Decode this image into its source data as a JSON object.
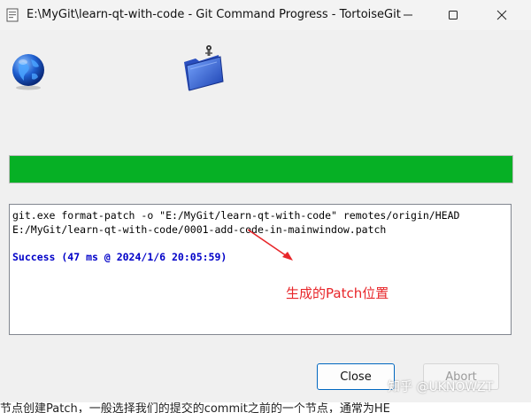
{
  "window": {
    "title": "E:\\MyGit\\learn-qt-with-code - Git Command Progress - TortoiseGit"
  },
  "icons": {
    "app": "tortoisegit-app-icon",
    "globe": "globe-icon",
    "folder": "folder-icon",
    "minimize": "minimize-icon",
    "maximize": "maximize-icon",
    "close": "close-icon"
  },
  "progress": {
    "percent": 100,
    "color": "#06b025"
  },
  "log": {
    "lines": [
      "git.exe format-patch -o \"E:/MyGit/learn-qt-with-code\" remotes/origin/HEAD",
      "E:/MyGit/learn-qt-with-code/0001-add-code-in-mainwindow.patch",
      "Success (47 ms @ 2024/1/6 20:05:59)"
    ]
  },
  "annotation": {
    "text": "生成的Patch位置",
    "color": "#e8262a"
  },
  "buttons": {
    "close_label": "Close",
    "abort_label": "Abort"
  },
  "watermark": "知乎 @UKNOWZT",
  "bottom_text": "节点创建Patch，一般选择我们的提交的commit之前的一个节点，通常为HE"
}
